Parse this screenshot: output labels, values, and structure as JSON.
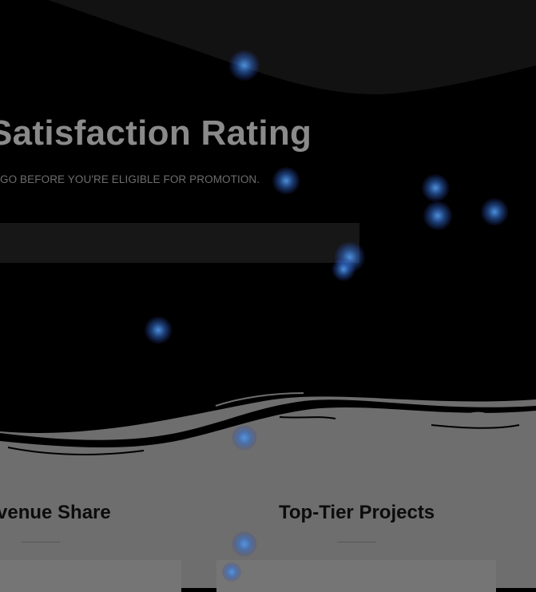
{
  "hero": {
    "title": "atisfaction Rating",
    "title_prefix": "S",
    "subtitle": "GO BEFORE YOU'RE ELIGIBLE FOR PROMOTION."
  },
  "columns": [
    {
      "title": "venue Share"
    },
    {
      "title": "Top-Tier Projects"
    }
  ],
  "colors": {
    "background": "#000000",
    "top_wave": "#121212",
    "progress_track": "#171717",
    "bottom_section": "#6e6e6e",
    "glow": "#3a7fd0"
  },
  "decor": {
    "glow_count": 11,
    "icon": "glow-particle-icon"
  }
}
